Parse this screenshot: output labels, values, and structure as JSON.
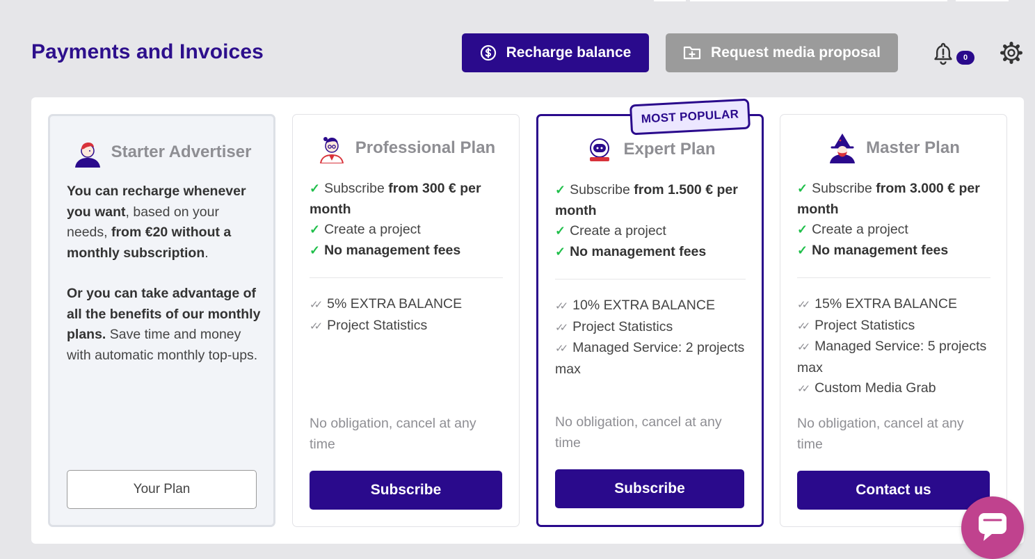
{
  "header": {
    "title": "Payments and Invoices",
    "recharge_label": "Recharge balance",
    "request_label": "Request media proposal",
    "notification_count": "0"
  },
  "colors": {
    "primary": "#2a0a8c",
    "title": "#2d0f8c",
    "check": "#1fbf4a",
    "muted": "#8e8e93",
    "chat": "#c0428e"
  },
  "plans": [
    {
      "name": "Starter Advertiser",
      "p1_b1": "You can recharge whenever you want",
      "p1_t1": ", based on your needs, ",
      "p1_b2": "from €20 without a monthly subscription",
      "p1_t2": ".",
      "p2_b1": "Or you can take advantage of all the benefits of our monthly plans.",
      "p2_t1": " Save time and money with automatic monthly top-ups.",
      "cta": "Your Plan"
    },
    {
      "name": "Professional Plan",
      "sub_text": "Subscribe ",
      "sub_bold": "from 300 € per month",
      "feature_project": "Create a project",
      "feature_fees": "No management fees",
      "extras": [
        "5% EXTRA BALANCE",
        "Project Statistics"
      ],
      "note": "No obligation, cancel at any time",
      "cta": "Subscribe"
    },
    {
      "name": "Expert Plan",
      "badge": "MOST POPULAR",
      "sub_text": "Subscribe ",
      "sub_bold": "from 1.500 € per month",
      "feature_project": "Create a project",
      "feature_fees": "No management fees",
      "extras": [
        "10% EXTRA BALANCE",
        "Project Statistics",
        "Managed Service: 2 projects max"
      ],
      "note": "No obligation, cancel at any time",
      "cta": "Subscribe"
    },
    {
      "name": "Master Plan",
      "sub_text": "Subscribe ",
      "sub_bold": "from 3.000 € per month",
      "feature_project": "Create a project",
      "feature_fees": "No management fees",
      "extras": [
        "15% EXTRA BALANCE",
        "Project Statistics",
        "Managed Service: 5 projects max",
        "Custom Media Grab"
      ],
      "note": "No obligation, cancel at any time",
      "cta": "Contact us"
    }
  ],
  "icons": {
    "recharge": "dollar-circle-icon",
    "request": "folder-plus-icon",
    "notifications": "bell-alert-icon",
    "settings": "gear-icon",
    "chat": "chat-bubble-icon"
  }
}
